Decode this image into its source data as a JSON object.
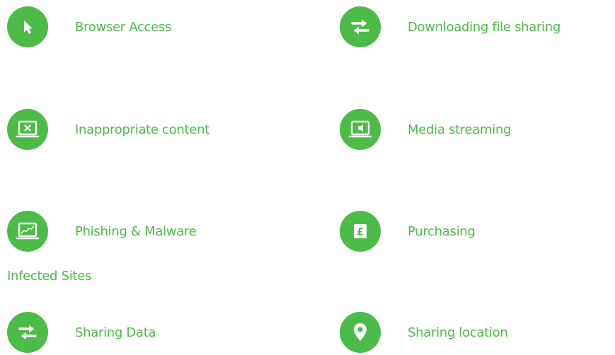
{
  "features": [
    {
      "id": "browser-access",
      "icon": "cursor-icon",
      "label": "Browser Access"
    },
    {
      "id": "downloading-file-sharing",
      "icon": "swap-arrows-icon",
      "label": "Downloading file sharing"
    },
    {
      "id": "inappropriate-content",
      "icon": "laptop-blocked-icon",
      "label": "Inappropriate content"
    },
    {
      "id": "media-streaming",
      "icon": "laptop-media-icon",
      "label": "Media streaming"
    },
    {
      "id": "phishing-malware",
      "icon": "laptop-chart-icon",
      "label": "Phishing & Malware",
      "sublabel": "Infected Sites"
    },
    {
      "id": "purchasing",
      "icon": "pound-icon",
      "label": "Purchasing"
    },
    {
      "id": "sharing-data",
      "icon": "swap-arrows-icon",
      "label": "Sharing Data"
    },
    {
      "id": "sharing-location",
      "icon": "location-pin-icon",
      "label": "Sharing location"
    }
  ],
  "colors": {
    "accent": "#4dbb47",
    "background": "#ffffff"
  }
}
